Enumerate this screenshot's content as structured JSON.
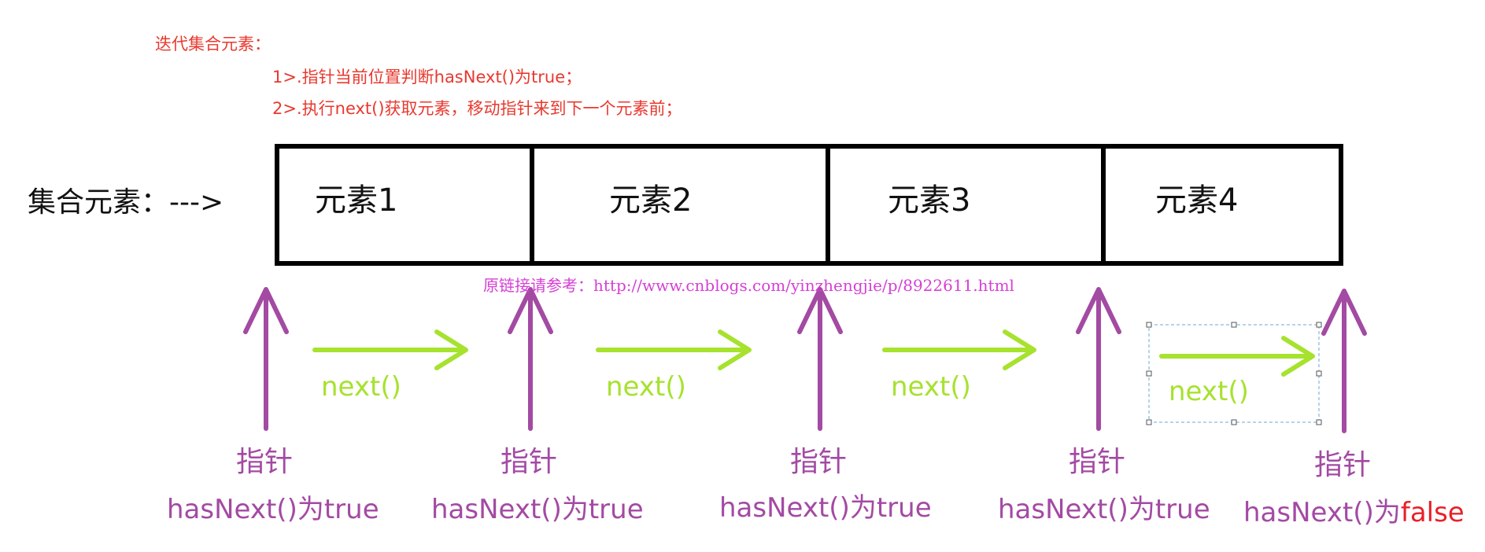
{
  "notes": {
    "title": "迭代集合元素：",
    "step1": "1>.指针当前位置判断hasNext()为true；",
    "step2": "2>.执行next()获取元素，移动指针来到下一个元素前；"
  },
  "collection_label": "集合元素：--->",
  "elements": [
    "元素1",
    "元素2",
    "元素3",
    "元素4"
  ],
  "watermark": "原链接请参考：http://www.cnblogs.com/yinzhengjie/p/8922611.html",
  "next_label": "next()",
  "pointer_label": "指针",
  "has_next": [
    {
      "prefix": "hasNext()为",
      "value": "true"
    },
    {
      "prefix": "hasNext()为",
      "value": "true"
    },
    {
      "prefix": "hasNext()为",
      "value": "true"
    },
    {
      "prefix": "hasNext()为",
      "value": "true"
    },
    {
      "prefix": "hasNext()为",
      "value": "false"
    }
  ],
  "colors": {
    "note_text": "#e8392f",
    "pointer_arrow": "#a34aa3",
    "next_arrow": "#a6e22e",
    "watermark": "#d63fd6",
    "false_value": "#e8212a",
    "box_border": "#000000"
  }
}
